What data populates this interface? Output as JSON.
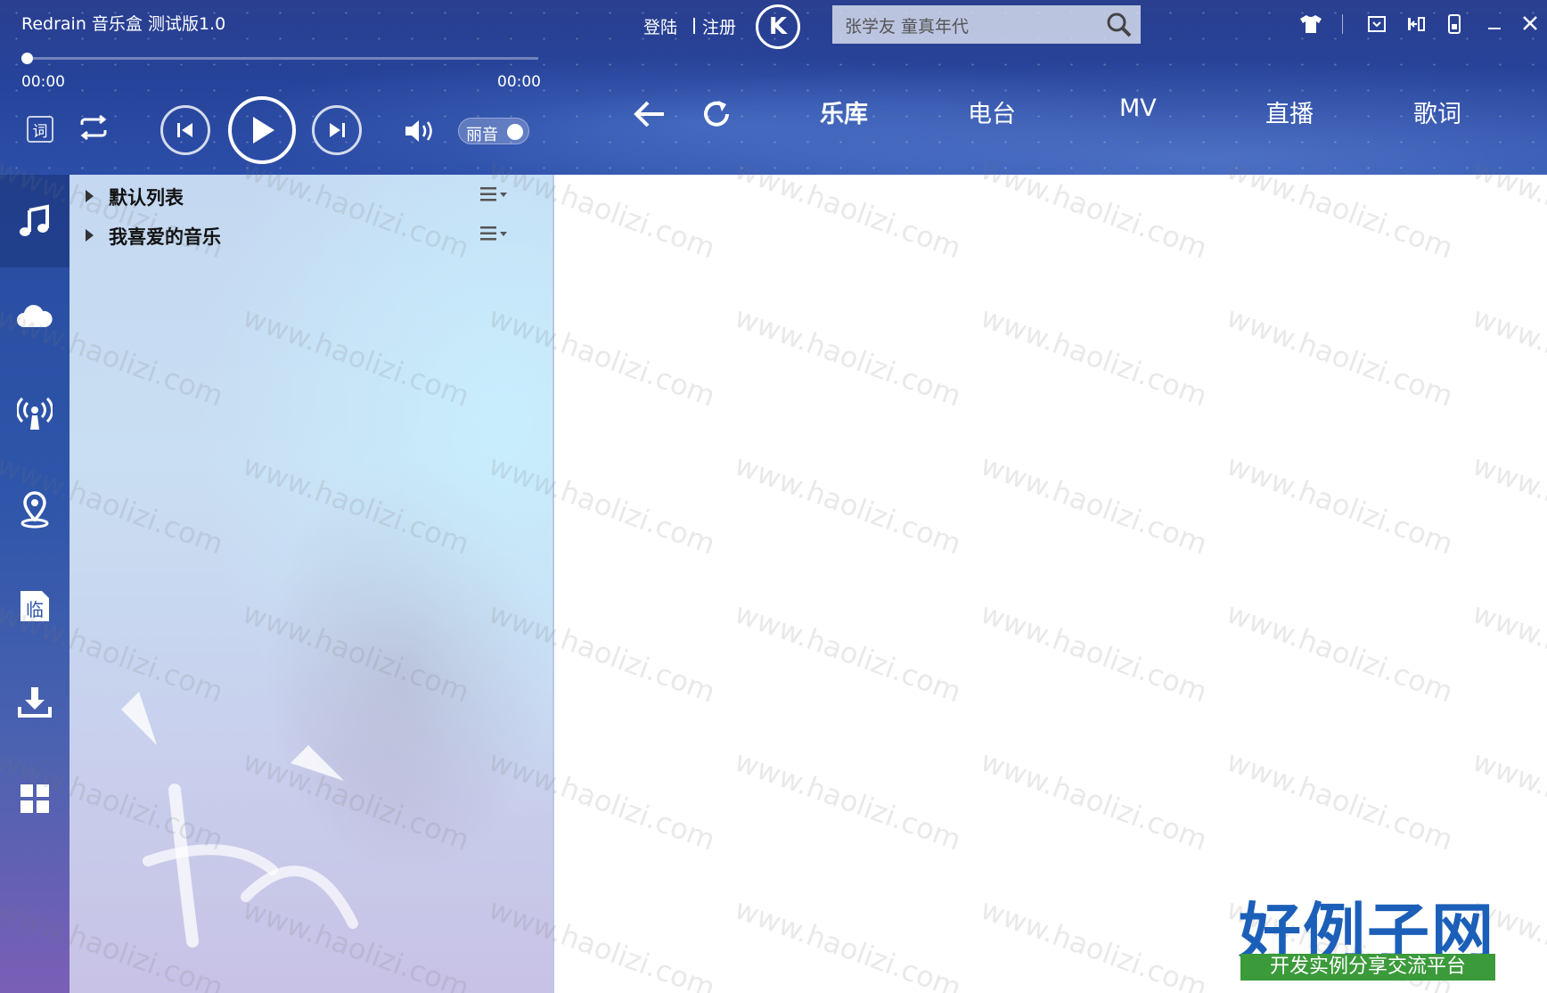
{
  "window": {
    "title": "Redrain 音乐盒 测试版1.0"
  },
  "player": {
    "current_time": "00:00",
    "total_time": "00:00",
    "progress": 0,
    "lyric_toggle_label": "词",
    "sound_effect_label": "丽音",
    "sound_effect_on": false
  },
  "account": {
    "login_label": "登陆",
    "register_label": "注册"
  },
  "search": {
    "value": "张学友 童真年代"
  },
  "nav": {
    "tabs": [
      {
        "label": "乐库",
        "active": true
      },
      {
        "label": "电台",
        "active": false
      },
      {
        "label": "MV",
        "active": false
      },
      {
        "label": "直播",
        "active": false
      },
      {
        "label": "歌词",
        "active": false
      }
    ]
  },
  "sidebar": {
    "items": [
      {
        "icon": "music-note-icon",
        "active": true
      },
      {
        "icon": "cloud-icon"
      },
      {
        "icon": "radio-broadcast-icon"
      },
      {
        "icon": "location-pin-icon"
      },
      {
        "icon": "temporary-list-icon",
        "glyph": "临"
      },
      {
        "icon": "download-icon"
      },
      {
        "icon": "apps-grid-icon"
      }
    ]
  },
  "playlists": [
    {
      "name": "默认列表"
    },
    {
      "name": "我喜爱的音乐"
    }
  ],
  "watermark": {
    "text": "www.haolizi.com"
  },
  "brand": {
    "name": "好例子网",
    "tagline": "开发实例分享交流平台"
  },
  "colors": {
    "header": "#2a3f8f",
    "panel": "#c9dcf2",
    "brand": "#1b5fb8",
    "brand_tag_bg": "#3b9a3a"
  }
}
